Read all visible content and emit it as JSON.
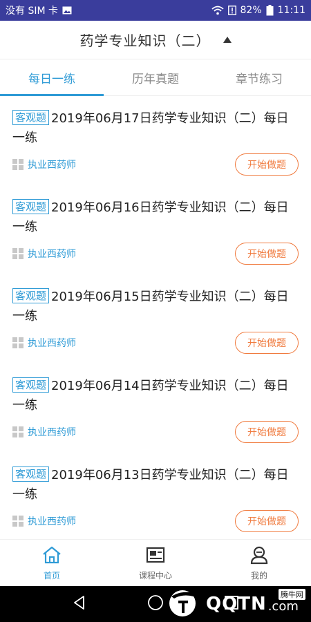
{
  "status_bar": {
    "carrier": "没有 SIM 卡",
    "battery": "82%",
    "time": "11:11"
  },
  "header": {
    "title": "药学专业知识（二）"
  },
  "tabs": [
    {
      "label": "每日一练",
      "active": true
    },
    {
      "label": "历年真题",
      "active": false
    },
    {
      "label": "章节练习",
      "active": false
    }
  ],
  "list": [
    {
      "badge": "客观题",
      "title": "2019年06月17日药学专业知识（二）每日一练",
      "category": "执业西药师",
      "action": "开始做题"
    },
    {
      "badge": "客观题",
      "title": "2019年06月16日药学专业知识（二）每日一练",
      "category": "执业西药师",
      "action": "开始做题"
    },
    {
      "badge": "客观题",
      "title": "2019年06月15日药学专业知识（二）每日一练",
      "category": "执业西药师",
      "action": "开始做题"
    },
    {
      "badge": "客观题",
      "title": "2019年06月14日药学专业知识（二）每日一练",
      "category": "执业西药师",
      "action": "开始做题"
    },
    {
      "badge": "客观题",
      "title": "2019年06月13日药学专业知识（二）每日一练",
      "category": "执业西药师",
      "action": "开始做题"
    }
  ],
  "bottom_nav": [
    {
      "label": "首页",
      "icon": "home-icon",
      "active": true
    },
    {
      "label": "课程中心",
      "icon": "course-icon",
      "active": false
    },
    {
      "label": "我的",
      "icon": "profile-icon",
      "active": false
    }
  ],
  "watermark": {
    "text": "QQTN",
    "suffix": ".com",
    "tag": "腾牛网"
  },
  "colors": {
    "status_bar": "#3a3d9c",
    "accent": "#2f9bd6",
    "action": "#f07b3f"
  }
}
